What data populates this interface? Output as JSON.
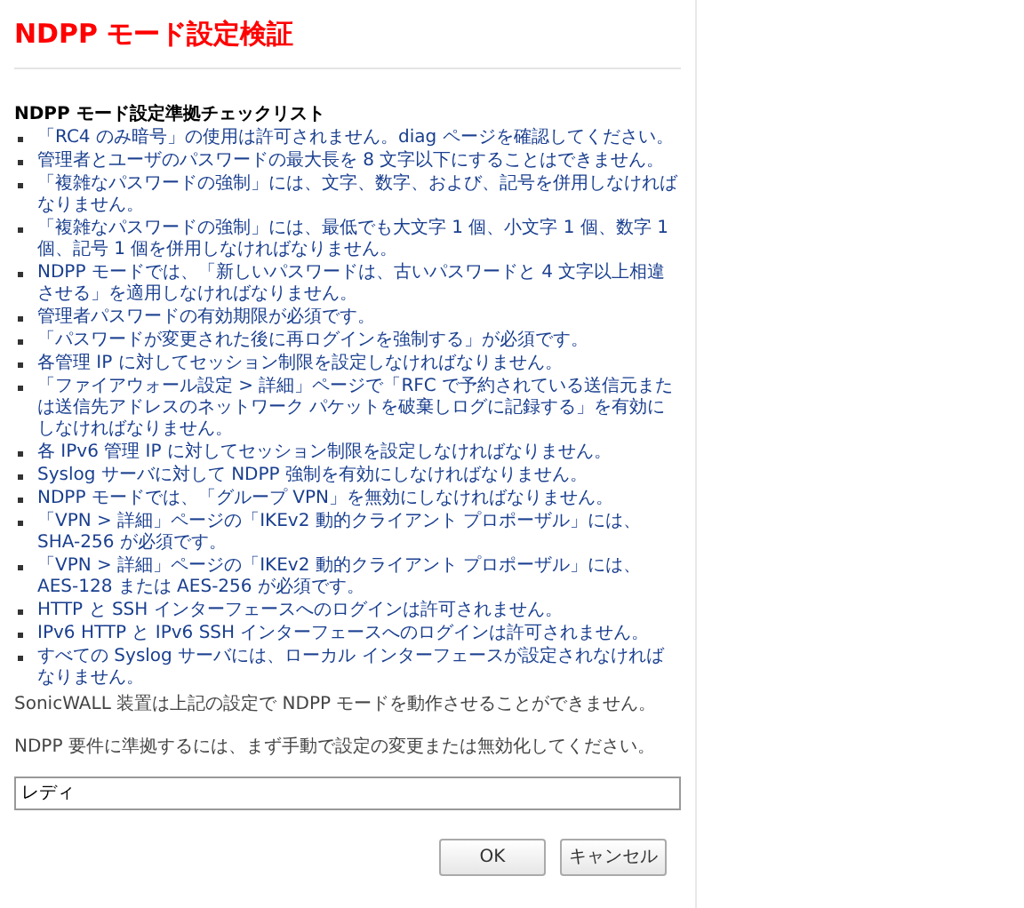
{
  "title": "NDPP モード設定検証",
  "checklist": {
    "heading": "NDPP モード設定準拠チェックリスト",
    "items": [
      "「RC4 のみ暗号」の使用は許可されません。diag ページを確認してください。",
      "管理者とユーザのパスワードの最大長を 8 文字以下にすることはできません。",
      "「複雑なパスワードの強制」には、文字、数字、および、記号を併用しなければなりません。",
      "「複雑なパスワードの強制」には、最低でも大文字 1 個、小文字 1 個、数字 1 個、記号 1 個を併用しなければなりません。",
      "NDPP モードでは、「新しいパスワードは、古いパスワードと 4 文字以上相違させる」を適用しなければなりません。",
      "管理者パスワードの有効期限が必須です。",
      "「パスワードが変更された後に再ログインを強制する」が必須です。",
      "各管理 IP に対してセッション制限を設定しなければなりません。",
      "「ファイアウォール設定 > 詳細」ページで「RFC で予約されている送信元または送信先アドレスのネットワーク パケットを破棄しログに記録する」を有効にしなければなりません。",
      "各 IPv6 管理 IP に対してセッション制限を設定しなければなりません。",
      "Syslog サーバに対して NDPP 強制を有効にしなければなりません。",
      "NDPP モードでは、「グループ VPN」を無効にしなければなりません。",
      "「VPN > 詳細」ページの「IKEv2 動的クライアント プロポーザル」には、SHA-256 が必須です。",
      "「VPN > 詳細」ページの「IKEv2 動的クライアント プロポーザル」には、AES-128 または AES-256 が必須です。",
      "HTTP と SSH インターフェースへのログインは許可されません。",
      "IPv6 HTTP と IPv6 SSH インターフェースへのログインは許可されません。",
      "すべての Syslog サーバには、ローカル インターフェースが設定されなければなりません。"
    ]
  },
  "messages": [
    "SonicWALL 装置は上記の設定で NDPP モードを動作させることができません。",
    "NDPP 要件に準拠するには、まず手動で設定の変更または無効化してください。"
  ],
  "status_field": {
    "value": "レディ"
  },
  "buttons": [
    "OK",
    "キャンセル"
  ]
}
